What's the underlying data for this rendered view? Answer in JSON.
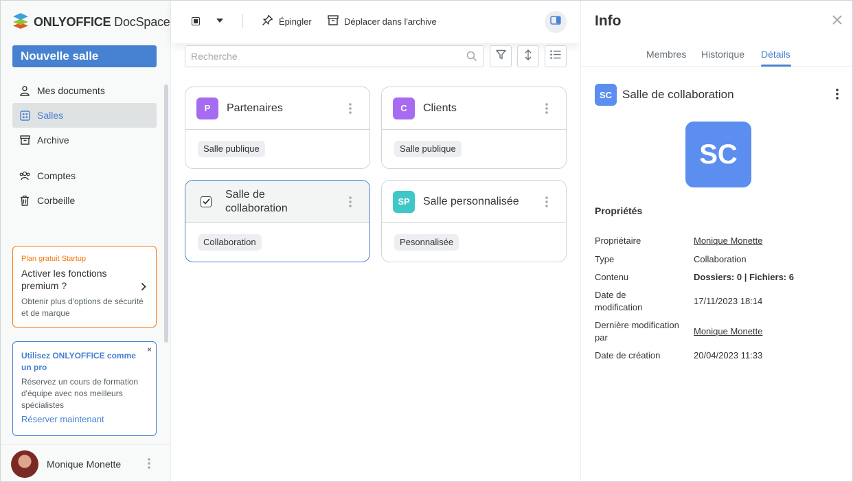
{
  "app": {
    "brand_bold": "ONLYOFFICE",
    "brand_light": "DocSpace",
    "accent": "#4781d1"
  },
  "sidebar": {
    "new_room_label": "Nouvelle salle",
    "items": [
      {
        "label": "Mes documents",
        "icon": "user-icon"
      },
      {
        "label": "Salles",
        "icon": "rooms-icon",
        "active": true
      },
      {
        "label": "Archive",
        "icon": "archive-icon"
      },
      {
        "label": "Comptes",
        "icon": "accounts-icon"
      },
      {
        "label": "Corbeille",
        "icon": "trash-icon"
      }
    ],
    "promo": {
      "header": "Plan gratuit Startup",
      "title": "Activer les fonctions premium ?",
      "description": "Obtenir plus d'options de sécurité et de marque"
    },
    "pro_banner": {
      "title": "Utilisez ONLYOFFICE comme un pro",
      "description": "Réservez un cours de formation d'équipe avec nos meilleurs spécialistes",
      "link": "Réserver maintenant",
      "close": "×"
    },
    "user_name": "Monique Monette"
  },
  "toolbar": {
    "pin_label": "Épingler",
    "archive_label": "Déplacer dans l'archive"
  },
  "search": {
    "placeholder": "Recherche"
  },
  "rooms": [
    {
      "initials": "P",
      "title": "Partenaires",
      "tag": "Salle publique",
      "color": "#a66bf0"
    },
    {
      "initials": "C",
      "title": "Clients",
      "tag": "Salle publique",
      "color": "#a66bf0"
    },
    {
      "initials": "",
      "title": "Salle de collaboration",
      "tag": "Collaboration",
      "selected": true
    },
    {
      "initials": "SP",
      "title": "Salle personnalisée",
      "tag": "Pesonnalisée",
      "color": "#3fc7c7"
    }
  ],
  "info_panel": {
    "title": "Info",
    "tabs": [
      "Membres",
      "Historique",
      "Détails"
    ],
    "active_tab": "Détails",
    "room_initials": "SC",
    "room_name": "Salle de collaboration",
    "properties_title": "Propriétés",
    "properties": [
      {
        "label": "Propriétaire",
        "value": "Monique Monette",
        "style": "link"
      },
      {
        "label": "Type",
        "value": "Collaboration"
      },
      {
        "label": "Contenu",
        "value": "Dossiers: 0 | Fichiers: 6",
        "style": "bold"
      },
      {
        "label": "Date de modification",
        "value": "17/11/2023 18:14"
      },
      {
        "label": "Dernière modification par",
        "value": "Monique Monette",
        "style": "link"
      },
      {
        "label": "Date de création",
        "value": "20/04/2023 11:33"
      }
    ]
  }
}
